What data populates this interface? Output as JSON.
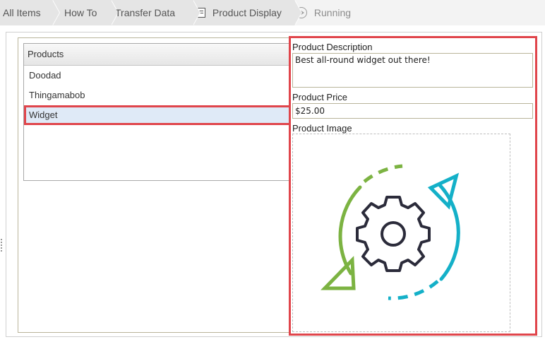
{
  "breadcrumb": {
    "items": [
      "All Items",
      "How To",
      "Transfer Data",
      "Product Display"
    ],
    "running": "Running"
  },
  "products_list": {
    "header": "Products",
    "items": [
      "Doodad",
      "Thingamabob",
      "Widget"
    ],
    "selected": "Widget"
  },
  "details": {
    "description_label": "Product Description",
    "description_value": "Best all-round widget out there!",
    "price_label": "Product Price",
    "price_value": "$25.00",
    "image_label": "Product Image",
    "image_icon": "sync-gear-icon"
  },
  "colors": {
    "highlight": "#e0454b",
    "selected_bg": "#dfeaf7",
    "arrow_green": "#7cb342",
    "arrow_teal": "#14b0c8",
    "gear": "#2b2b3a"
  }
}
